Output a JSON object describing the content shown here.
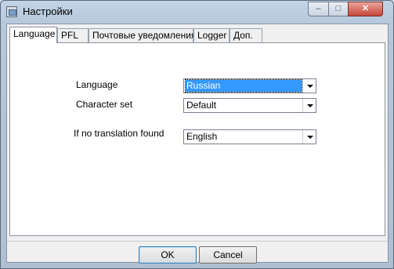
{
  "window": {
    "title": "Настройки",
    "controls": {
      "minimize": "–",
      "maximize": "□",
      "close": "✕"
    }
  },
  "tabs": [
    {
      "label": "Language",
      "active": true
    },
    {
      "label": "PFL",
      "active": false
    },
    {
      "label": "Почтовые уведомления",
      "active": false
    },
    {
      "label": "Logger",
      "active": false
    },
    {
      "label": "Доп.",
      "active": false
    }
  ],
  "form": {
    "language": {
      "label": "Language",
      "value": "Russian"
    },
    "charset": {
      "label": "Character set",
      "value": "Default"
    },
    "fallback": {
      "label": "If no translation found",
      "value": "English"
    }
  },
  "buttons": {
    "ok": "OK",
    "cancel": "Cancel"
  },
  "colors": {
    "selection": "#3399ff",
    "title_bar": "#c3d4e6",
    "close_button": "#c7473a"
  }
}
